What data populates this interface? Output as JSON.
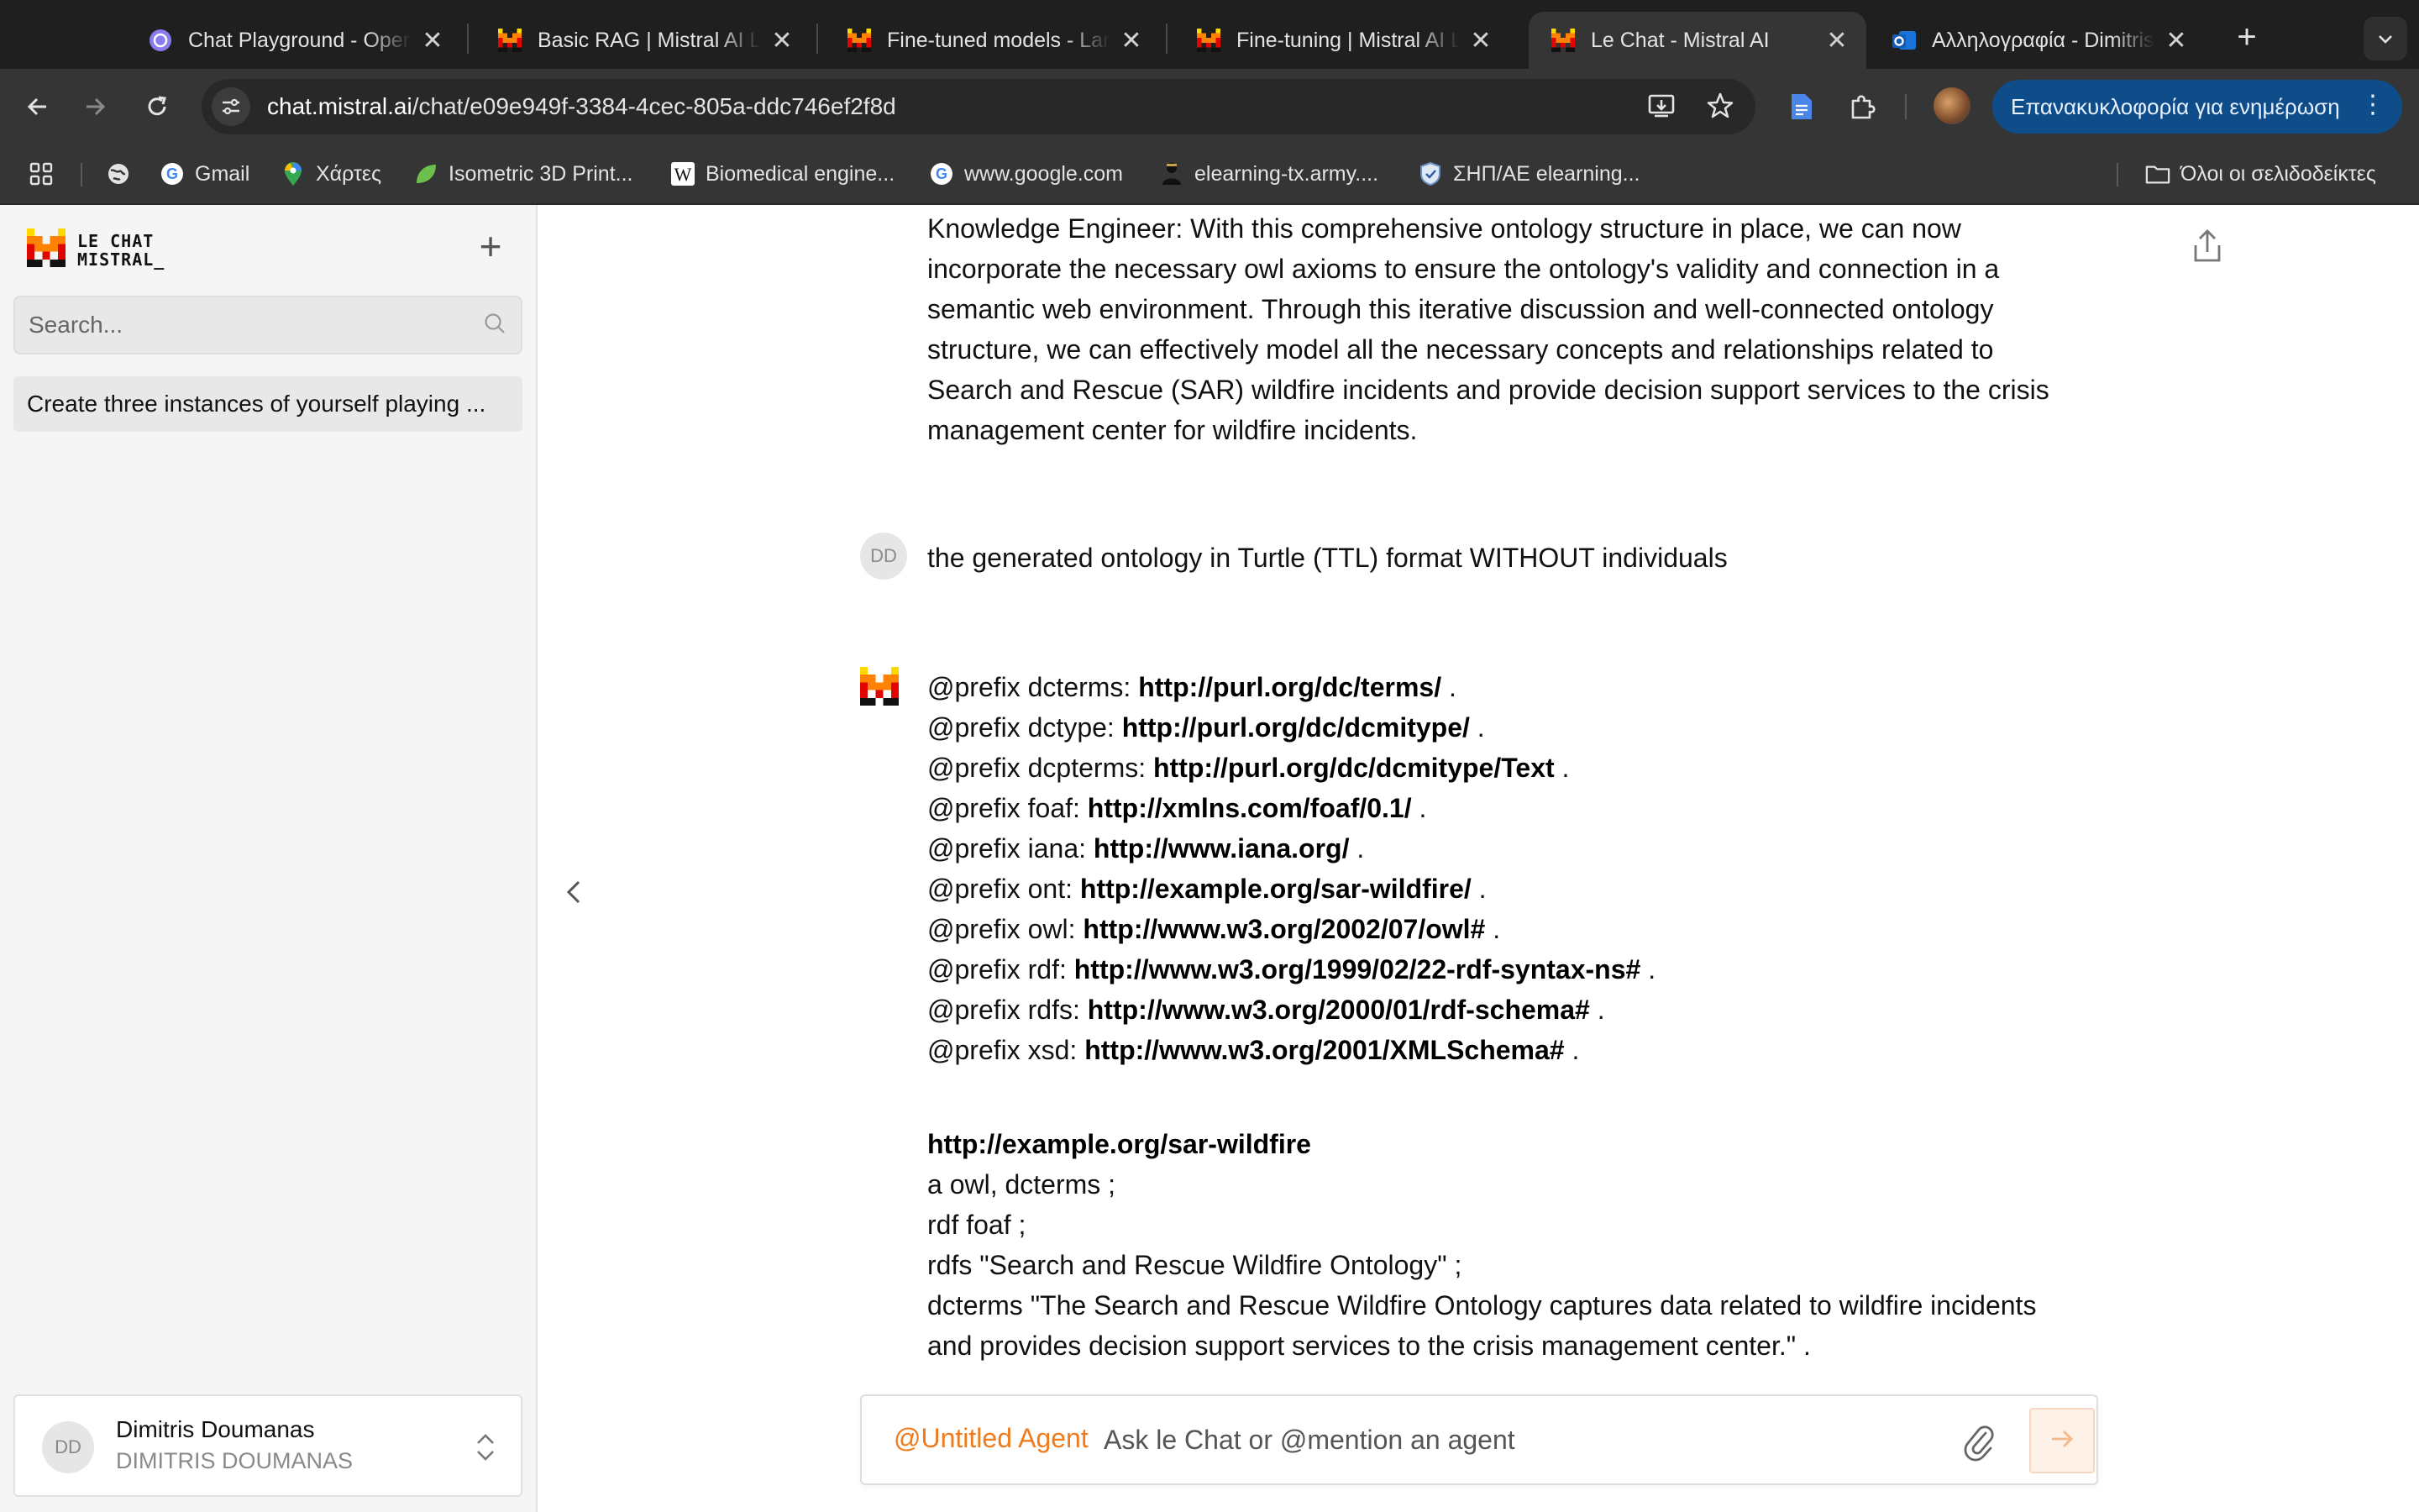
{
  "browser": {
    "tabs": [
      {
        "title": "Chat Playground - OpenAI API",
        "favicon": "openai-icon",
        "active": false
      },
      {
        "title": "Basic RAG | Mistral AI Large Language Models",
        "favicon": "mistral-icon",
        "active": false
      },
      {
        "title": "Fine-tuned models - Large Language Models",
        "favicon": "mistral-icon",
        "active": false
      },
      {
        "title": "Fine-tuning | Mistral AI Large Language Models",
        "favicon": "mistral-icon",
        "active": false
      },
      {
        "title": "Le Chat - Mistral AI",
        "favicon": "mistral-icon",
        "active": true
      },
      {
        "title": "Αλληλογραφία - Dimitris Doumanas",
        "favicon": "outlook-icon",
        "active": false
      }
    ],
    "url_host": "chat.mistral.ai",
    "url_path": "/chat/e09e949f-3384-4cec-805a-ddc746ef2f8d",
    "update_button": "Επανακυκλοφορία για ενημέρωση",
    "bookmarks": [
      {
        "label": "",
        "icon": "apps-grid-icon"
      },
      {
        "label": "",
        "icon": "globe-icon"
      },
      {
        "label": "Gmail",
        "icon": "google-icon"
      },
      {
        "label": "Χάρτες",
        "icon": "maps-pin-icon"
      },
      {
        "label": "Isometric 3D Print...",
        "icon": "leaf-icon"
      },
      {
        "label": "Biomedical engine...",
        "icon": "wikipedia-icon"
      },
      {
        "label": "www.google.com",
        "icon": "google-icon"
      },
      {
        "label": "elearning-tx.army....",
        "icon": "army-icon"
      },
      {
        "label": "ΣΗΠ/ΑΕ elearning...",
        "icon": "shield-icon"
      }
    ],
    "all_bookmarks": "Όλοι οι σελιδοδείκτες"
  },
  "sidebar": {
    "brand_line1": "LE CHAT",
    "brand_line2": "MISTRAL_",
    "search_placeholder": "Search...",
    "conversations": [
      "Create three instances of yourself playing ..."
    ],
    "user": {
      "initials": "DD",
      "name": "Dimitris Doumanas",
      "subtitle": "DIMITRIS DOUMANAS"
    }
  },
  "chat": {
    "prev_assistant_lines": [
      "Knowledge Engineer: With this comprehensive ontology structure in place, we can now",
      "incorporate the necessary owl axioms to ensure the ontology's validity and connection in a",
      "semantic web environment. Through this iterative discussion and well-connected ontology",
      "structure, we can effectively model all the necessary concepts and relationships related to",
      "Search and Rescue (SAR) wildfire incidents and provide decision support services to the crisis",
      "management center for wildfire incidents."
    ],
    "user_message": {
      "initials": "DD",
      "text": "the generated ontology in Turtle (TTL) format WITHOUT individuals"
    },
    "prefixes": [
      {
        "pre": "@prefix dcterms: ",
        "link": "http://purl.org/dc/terms/",
        "post": " ."
      },
      {
        "pre": "@prefix dctype: ",
        "link": "http://purl.org/dc/dcmitype/",
        "post": " ."
      },
      {
        "pre": "@prefix dcpterms: ",
        "link": "http://purl.org/dc/dcmitype/Text",
        "post": " ."
      },
      {
        "pre": "@prefix foaf: ",
        "link": "http://xmlns.com/foaf/0.1/",
        "post": " ."
      },
      {
        "pre": "@prefix iana: ",
        "link": "http://www.iana.org/",
        "post": " ."
      },
      {
        "pre": "@prefix ont: ",
        "link": "http://example.org/sar-wildfire/",
        "post": " ."
      },
      {
        "pre": "@prefix owl: ",
        "link": "http://www.w3.org/2002/07/owl#",
        "post": " ."
      },
      {
        "pre": "@prefix rdf: ",
        "link": "http://www.w3.org/1999/02/22-rdf-syntax-ns#",
        "post": " ."
      },
      {
        "pre": "@prefix rdfs: ",
        "link": "http://www.w3.org/2000/01/rdf-schema#",
        "post": " ."
      },
      {
        "pre": "@prefix xsd: ",
        "link": "http://www.w3.org/2001/XMLSchema#",
        "post": " ."
      }
    ],
    "ontology_link": "http://example.org/sar-wildfire",
    "ontology_lines": [
      "a owl, dcterms ;",
      "rdf foaf ;",
      "rdfs \"Search and Rescue Wildfire Ontology\" ;",
      "dcterms \"The Search and Rescue Wildfire Ontology captures data related to wildfire incidents",
      "and provides decision support services to the crisis management center.\" ."
    ]
  },
  "composer": {
    "agent_tag": "@Untitled Agent",
    "placeholder": "Ask le Chat or @mention an agent"
  },
  "colors": {
    "accent": "#f07b1c",
    "mistral_orange": "#ff8205",
    "mistral_red": "#e10500",
    "mistral_yellow": "#ffd800",
    "chrome_dark": "#1f1f1f",
    "chrome_toolbar": "#353535"
  }
}
